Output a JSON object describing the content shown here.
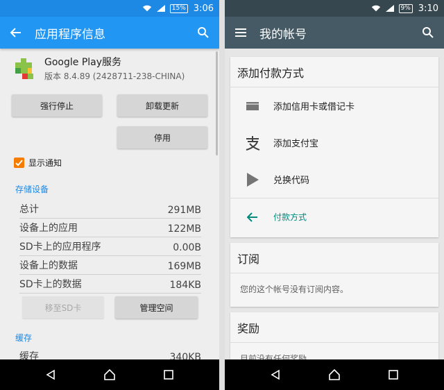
{
  "left": {
    "status": {
      "battery": "15%",
      "time": "3:06"
    },
    "toolbar": {
      "title": "应用程序信息"
    },
    "app": {
      "name": "Google Play服务",
      "version": "版本 8.4.89 (2428711-238-CHINA)"
    },
    "buttons": {
      "force_stop": "强行停止",
      "uninstall_updates": "卸载更新",
      "disable": "停用"
    },
    "notification": {
      "label": "显示通知",
      "checked": true
    },
    "storage": {
      "header": "存储设备",
      "rows": [
        {
          "label": "总计",
          "value": "291MB"
        },
        {
          "label": "设备上的应用",
          "value": "122MB"
        },
        {
          "label": "SD卡上的应用程序",
          "value": "0.00B"
        },
        {
          "label": "设备上的数据",
          "value": "169MB"
        },
        {
          "label": "SD卡上的数据",
          "value": "184KB"
        }
      ],
      "move_to_sd": "移至SD卡",
      "manage_space": "管理空间"
    },
    "cache": {
      "header": "缓存",
      "rows": [
        {
          "label": "缓存",
          "value": "340KB"
        }
      ]
    }
  },
  "right": {
    "status": {
      "battery": "9%",
      "time": "3:10"
    },
    "toolbar": {
      "title": "我的帐号"
    },
    "payment": {
      "title": "添加付款方式",
      "items": [
        {
          "icon": "credit-card-icon",
          "label": "添加信用卡或借记卡"
        },
        {
          "icon": "alipay-icon",
          "label": "添加支付宝"
        },
        {
          "icon": "play-store-icon",
          "label": "兑换代码"
        }
      ],
      "back_label": "付款方式"
    },
    "subscriptions": {
      "title": "订阅",
      "body": "您的这个帐号没有订阅内容。"
    },
    "rewards": {
      "title": "奖励",
      "body": "目前没有任何奖励。"
    }
  },
  "colors": {
    "accent_blue": "#2196f3",
    "dark_toolbar": "#455a64",
    "checkbox_orange": "#f57c00",
    "teal": "#00897b"
  }
}
